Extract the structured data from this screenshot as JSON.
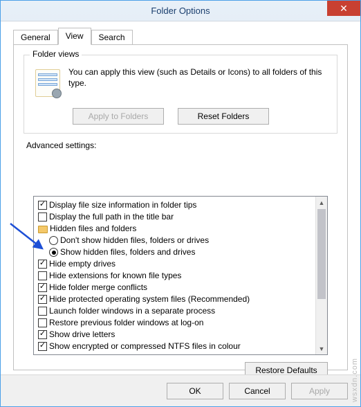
{
  "window": {
    "title": "Folder Options"
  },
  "tabs": {
    "general": "General",
    "view": "View",
    "search": "Search",
    "active": "view"
  },
  "folder_views": {
    "legend": "Folder views",
    "description": "You can apply this view (such as Details or Icons) to all folders of this type.",
    "apply_btn": "Apply to Folders",
    "reset_btn": "Reset Folders"
  },
  "advanced": {
    "label": "Advanced settings:",
    "restore_defaults": "Restore Defaults",
    "items": [
      {
        "type": "checkbox",
        "checked": true,
        "label": "Display file size information in folder tips"
      },
      {
        "type": "checkbox",
        "checked": false,
        "label": "Display the full path in the title bar"
      },
      {
        "type": "group",
        "label": "Hidden files and folders"
      },
      {
        "type": "radio",
        "checked": false,
        "indent": true,
        "label": "Don't show hidden files, folders or drives"
      },
      {
        "type": "radio",
        "checked": true,
        "indent": true,
        "label": "Show hidden files, folders and drives"
      },
      {
        "type": "checkbox",
        "checked": true,
        "label": "Hide empty drives"
      },
      {
        "type": "checkbox",
        "checked": false,
        "label": "Hide extensions for known file types"
      },
      {
        "type": "checkbox",
        "checked": true,
        "label": "Hide folder merge conflicts"
      },
      {
        "type": "checkbox",
        "checked": true,
        "label": "Hide protected operating system files (Recommended)"
      },
      {
        "type": "checkbox",
        "checked": false,
        "label": "Launch folder windows in a separate process"
      },
      {
        "type": "checkbox",
        "checked": false,
        "label": "Restore previous folder windows at log-on"
      },
      {
        "type": "checkbox",
        "checked": true,
        "label": "Show drive letters"
      },
      {
        "type": "checkbox",
        "checked": true,
        "label": "Show encrypted or compressed NTFS files in colour"
      }
    ]
  },
  "buttons": {
    "ok": "OK",
    "cancel": "Cancel",
    "apply": "Apply"
  },
  "watermark": "wsxdn.com"
}
